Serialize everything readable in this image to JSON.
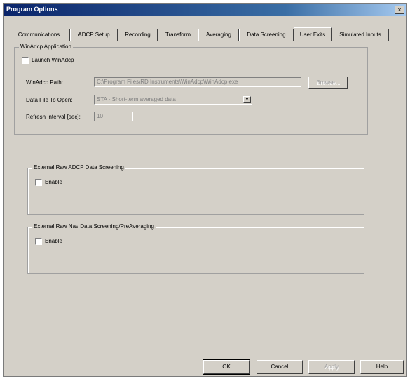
{
  "window": {
    "title": "Program Options",
    "close_glyph": "×"
  },
  "tabs": [
    {
      "label": "Communications"
    },
    {
      "label": "ADCP Setup"
    },
    {
      "label": "Recording"
    },
    {
      "label": "Transform"
    },
    {
      "label": "Averaging"
    },
    {
      "label": "Data Screening"
    },
    {
      "label": "User Exits",
      "active": true
    },
    {
      "label": "Simulated Inputs"
    }
  ],
  "winadcp_group": {
    "label": "WinAdcp Application",
    "launch_label": "Launch WinAdcp",
    "launch_checked": false,
    "path_label": "WinAdcp Path:",
    "path_value": "C:\\Program Files\\RD Instruments\\WinAdcp\\WinAdcp.exe",
    "browse_label": "Browse...",
    "data_file_label": "Data File To Open:",
    "data_file_value": "STA - Short-term averaged data",
    "refresh_label": "Refresh Interval [sec]:",
    "refresh_value": "10"
  },
  "raw_adcp_group": {
    "label": "External Raw ADCP Data Screening",
    "enable_label": "Enable",
    "enable_checked": false
  },
  "raw_nav_group": {
    "label": "External Raw Nav Data Screening/PreAveraging",
    "enable_label": "Enable",
    "enable_checked": false
  },
  "buttons": {
    "ok": "OK",
    "cancel": "Cancel",
    "apply": "Apply",
    "help": "Help"
  },
  "colors": {
    "titlebar": "#0a246a",
    "face": "#d4d0c8"
  },
  "icons": {
    "close": "close-icon",
    "dropdown": "chevron-down-icon"
  }
}
